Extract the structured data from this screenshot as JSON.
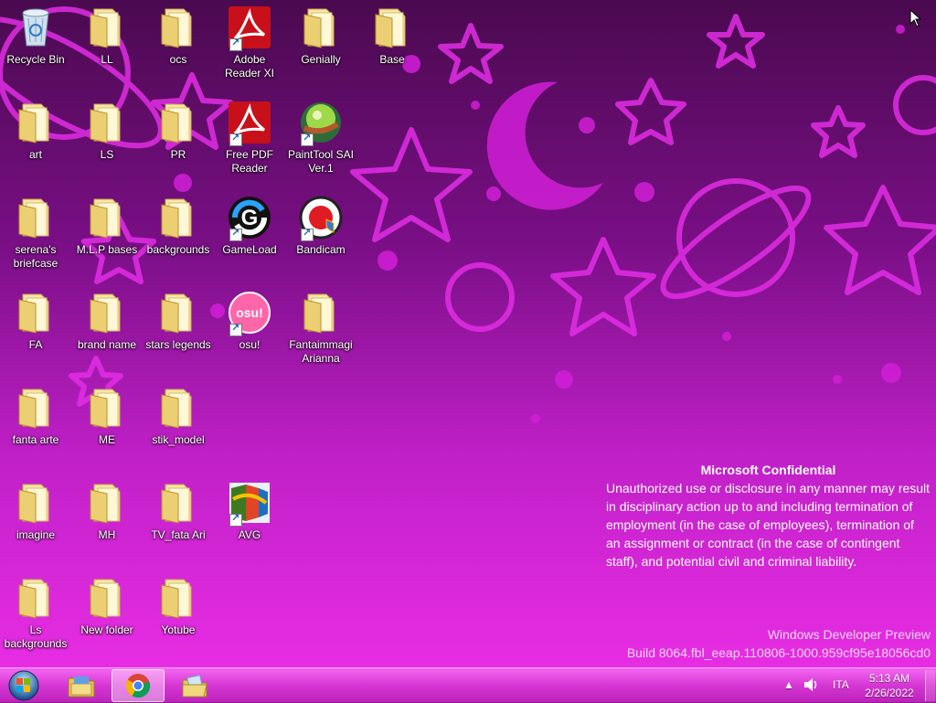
{
  "desktop": {
    "icons": [
      {
        "label": "Recycle Bin",
        "icon": "recycle-bin-icon"
      },
      {
        "label": "LL",
        "icon": "folder-icon"
      },
      {
        "label": "ocs",
        "icon": "folder-icon"
      },
      {
        "label": "Adobe Reader XI",
        "icon": "adobe-reader-icon"
      },
      {
        "label": "Genially",
        "icon": "folder-icon"
      },
      {
        "label": "Base",
        "icon": "folder-icon"
      },
      {
        "label": "art",
        "icon": "folder-icon"
      },
      {
        "label": "LS",
        "icon": "folder-icon"
      },
      {
        "label": "PR",
        "icon": "folder-icon"
      },
      {
        "label": "Free PDF Reader",
        "icon": "free-pdf-reader-icon"
      },
      {
        "label": "PaintTool SAI Ver.1",
        "icon": "painttool-sai-icon"
      },
      {
        "label": "serena's briefcase",
        "icon": "folder-icon"
      },
      {
        "label": "M.L.P bases",
        "icon": "folder-icon"
      },
      {
        "label": "backgrounds",
        "icon": "folder-icon"
      },
      {
        "label": "GameLoad",
        "icon": "gameload-icon"
      },
      {
        "label": "Bandicam",
        "icon": "bandicam-icon"
      },
      {
        "label": "FA",
        "icon": "folder-icon"
      },
      {
        "label": "brand name",
        "icon": "folder-icon"
      },
      {
        "label": "stars legends",
        "icon": "folder-icon"
      },
      {
        "label": "osu!",
        "icon": "osu-icon",
        "icon_text": "osu!"
      },
      {
        "label": "Fantaimmagi Arianna",
        "icon": "folder-icon"
      },
      {
        "label": "fanta arte",
        "icon": "folder-icon"
      },
      {
        "label": "ME",
        "icon": "folder-icon"
      },
      {
        "label": "stik_model",
        "icon": "folder-icon"
      },
      {
        "label": "imagine",
        "icon": "folder-icon"
      },
      {
        "label": "MH",
        "icon": "folder-icon"
      },
      {
        "label": "TV_fata Ari",
        "icon": "folder-icon"
      },
      {
        "label": "AVG",
        "icon": "avg-icon"
      },
      {
        "label": "Ls backgrounds",
        "icon": "folder-icon"
      },
      {
        "label": "New folder",
        "icon": "folder-icon"
      },
      {
        "label": "Yotube",
        "icon": "folder-icon"
      }
    ]
  },
  "watermark": {
    "title": "Microsoft Confidential",
    "body": "Unauthorized use or disclosure in any manner may result in disciplinary action up to and including termination of employment (in the case of employees), termination of an assignment or contract (in the case of contingent staff), and potential civil and criminal liability.",
    "product": "Windows Developer Preview",
    "build": "Build 8064.fbl_eeap.110806-1000.959cf95e18056cd0"
  },
  "taskbar": {
    "start": "start-orb-icon",
    "pinned": [
      {
        "icon": "file-explorer-icon",
        "active": false
      },
      {
        "icon": "chrome-icon",
        "active": true
      },
      {
        "icon": "folder-files-icon",
        "active": false
      }
    ],
    "tray": {
      "language": "ITA",
      "time": "5:13 AM",
      "date": "2/26/2022"
    }
  },
  "colors": {
    "wallpaper_top": "#4a0a4f",
    "wallpaper_bottom": "#ee2fe8",
    "shapes": "#d21fd8",
    "taskbar": "#c040c8"
  }
}
